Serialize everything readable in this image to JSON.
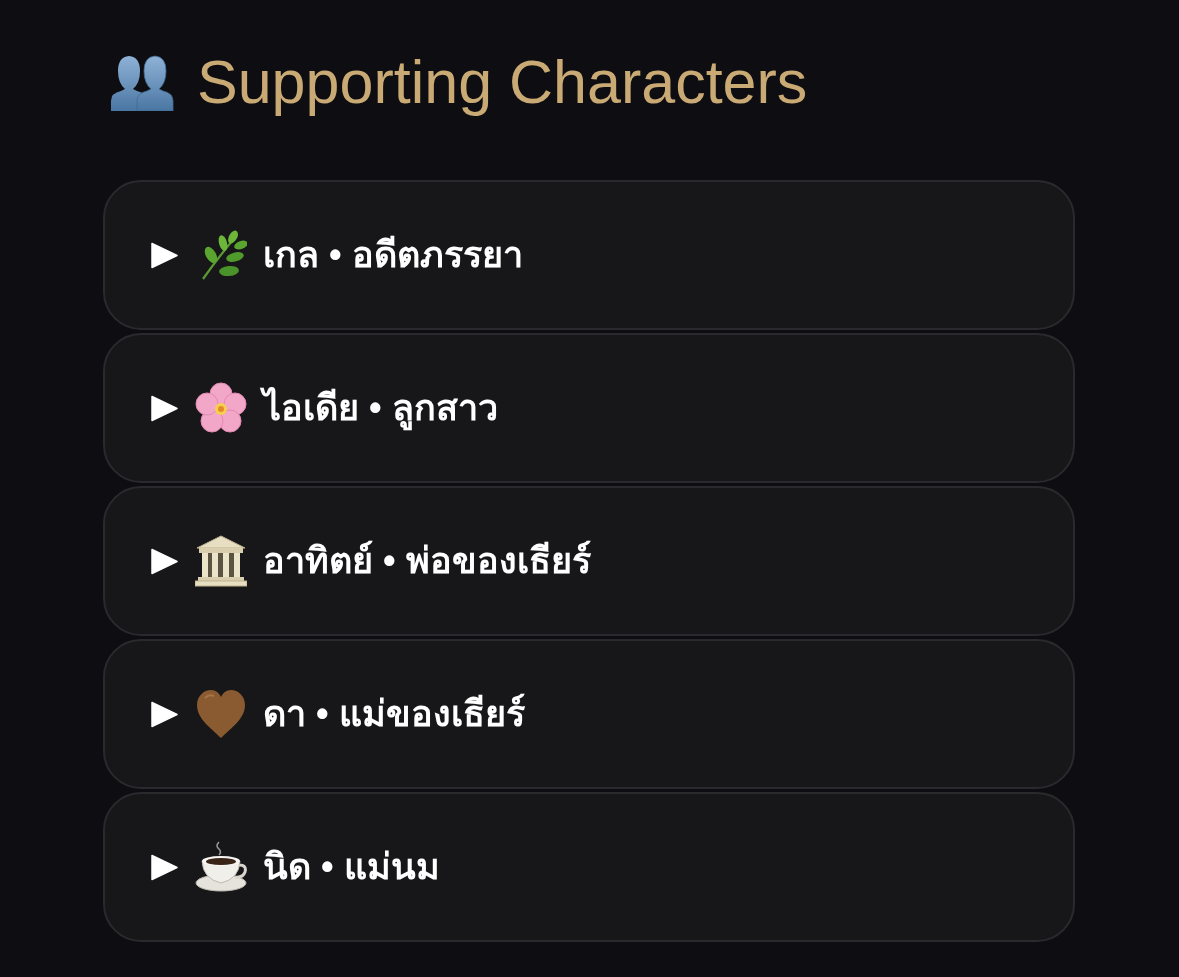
{
  "section": {
    "title": "Supporting Characters"
  },
  "characters": [
    {
      "kind": "herb",
      "label": "เกล • อดีตภรรยา",
      "expanded": false
    },
    {
      "kind": "blossom",
      "label": "ไอเดีย • ลูกสาว",
      "expanded": false
    },
    {
      "kind": "building",
      "label": "อาทิตย์ • พ่อของเธียร์",
      "expanded": false
    },
    {
      "kind": "heart",
      "label": "ดา • แม่ของเธียร์",
      "expanded": false
    },
    {
      "kind": "coffee",
      "label": "นิด • แม่นม",
      "expanded": false
    }
  ]
}
